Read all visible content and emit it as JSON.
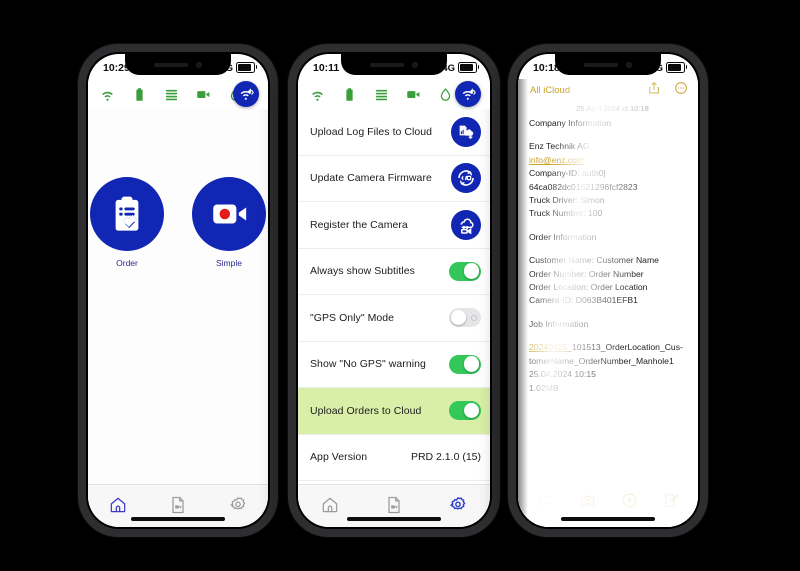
{
  "phone1": {
    "status": {
      "time": "10:29",
      "network": "4G"
    },
    "toolbar_icons": [
      "wifi-icon",
      "battery-icon",
      "list-icon",
      "video-camera-icon",
      "water-drop-icon"
    ],
    "fab": "wifi-sync-icon",
    "tiles": [
      {
        "icon": "clipboard-check-icon",
        "label": "Order"
      },
      {
        "icon": "video-record-icon",
        "label": "Simple"
      }
    ],
    "tabs": [
      {
        "icon": "home-icon",
        "active": true
      },
      {
        "icon": "document-video-icon",
        "active": false
      },
      {
        "icon": "gear-icon",
        "active": false
      }
    ]
  },
  "phone2": {
    "status": {
      "time": "10:11",
      "network": "4G"
    },
    "toolbar_icons": [
      "wifi-icon",
      "battery-icon",
      "list-icon",
      "video-camera-icon",
      "water-drop-icon"
    ],
    "fab": "wifi-sync-icon",
    "rows": [
      {
        "label": "Upload Log Files to Cloud",
        "control": "button",
        "icon": "upload-log-cloud-icon"
      },
      {
        "label": "Update Camera Firmware",
        "control": "button",
        "icon": "firmware-update-icon"
      },
      {
        "label": "Register the Camera",
        "control": "button",
        "icon": "cloud-camera-register-icon"
      },
      {
        "label": "Always show Subtitles",
        "control": "toggle",
        "state": "on"
      },
      {
        "label": "\"GPS Only\" Mode",
        "control": "toggle",
        "state": "off"
      },
      {
        "label": "Show \"No GPS\" warning",
        "control": "toggle",
        "state": "on"
      },
      {
        "label": "Upload Orders to Cloud",
        "control": "toggle",
        "state": "on",
        "highlight": true
      },
      {
        "label": "App Version",
        "control": "value",
        "value": "PRD 2.1.0 (15)"
      }
    ],
    "tabs": [
      {
        "icon": "home-icon",
        "active": false
      },
      {
        "icon": "document-video-icon",
        "active": false
      },
      {
        "icon": "gear-icon",
        "active": true
      }
    ]
  },
  "phone3": {
    "status": {
      "time": "10:18",
      "network": "4G"
    },
    "header": {
      "back": "All iCloud",
      "share": "share-icon",
      "more": "more-circle-icon"
    },
    "note": {
      "date": "25 April 2024 ct 10:18",
      "blocks": [
        {
          "type": "text",
          "text": "Company Information"
        },
        {
          "type": "space"
        },
        {
          "type": "text",
          "text": "Enz Technik AG"
        },
        {
          "type": "link",
          "text": "info@enz.com"
        },
        {
          "type": "text",
          "text": "Company-ID: auth0|"
        },
        {
          "type": "text",
          "text": "64ca082dc01621296fcf2823"
        },
        {
          "type": "text",
          "text": "Truck Driver: Simon"
        },
        {
          "type": "text",
          "text": "Truck Number: 100"
        },
        {
          "type": "space"
        },
        {
          "type": "text",
          "text": "Order Information"
        },
        {
          "type": "space"
        },
        {
          "type": "text",
          "text": "Customer Name: Customer Name"
        },
        {
          "type": "text",
          "text": "Order Number: Order Number"
        },
        {
          "type": "text",
          "text": "Order Location: Order Location"
        },
        {
          "type": "text",
          "text": "Camera-ID: D063B401EFB1"
        },
        {
          "type": "space"
        },
        {
          "type": "text",
          "text": "Job Information"
        },
        {
          "type": "space"
        },
        {
          "type": "link-line",
          "link": "20240425",
          "text": "_101513_OrderLocation_Cus-"
        },
        {
          "type": "text",
          "text": "tomerName_OrderNumber_Manhole1"
        },
        {
          "type": "text",
          "text": "25.04.2024 10:15"
        },
        {
          "type": "text",
          "text": "1.02MB"
        }
      ]
    },
    "tools": [
      "checklist-icon",
      "camera-icon",
      "markup-icon",
      "compose-icon"
    ]
  },
  "colors": {
    "brand_blue": "#1226b4",
    "green": "#3a9e3a",
    "toggle_green": "#34c759",
    "highlight_row": "#d9efa8",
    "notes_gold": "#c9a227",
    "record_red": "#e31b1b"
  }
}
